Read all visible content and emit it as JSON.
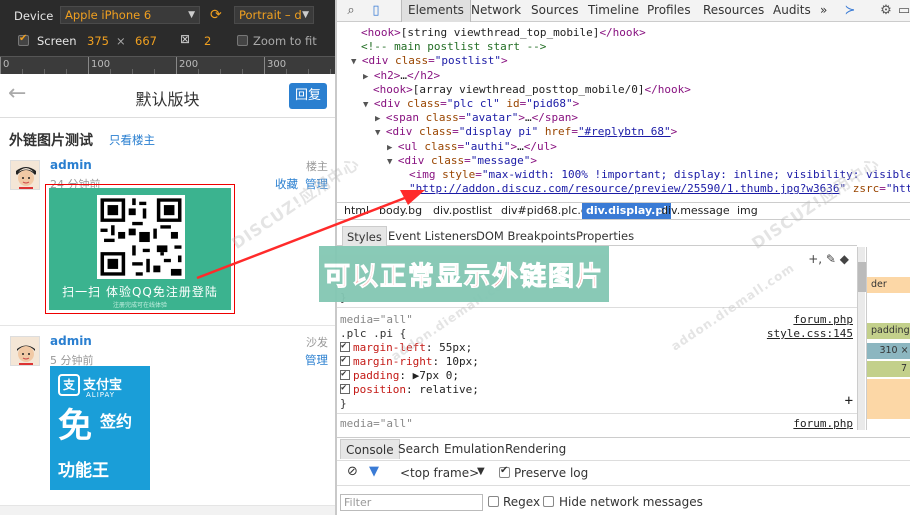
{
  "emulation": {
    "device_label": "Device",
    "device_value": "Apple iPhone 6",
    "orientation_value": "Portrait – d",
    "screen_label": "Screen",
    "screen_width": "375",
    "screen_times": "×",
    "screen_height": "667",
    "dpr_value": "2",
    "zoom_label": "Zoom to fit",
    "ruler_labels": [
      "0",
      "100",
      "200",
      "300"
    ]
  },
  "mobile": {
    "back_icon": "arrow-left-icon",
    "title": "默认版块",
    "reply_button": "回复",
    "thread_title": "外链图片测试",
    "only_author_link": "只看楼主",
    "posts": [
      {
        "author": "admin",
        "time": "24 分钟前",
        "floor": "楼主",
        "actions": [
          "收藏",
          "管理"
        ]
      },
      {
        "author": "admin",
        "time": "5 分钟前",
        "floor": "沙发",
        "actions": [
          "管理"
        ]
      }
    ],
    "qr_caption": "扫一扫 体验QQ免注册登陆",
    "qr_subcaption": "注册完成可在线体验",
    "alipay": {
      "logo": "支",
      "name": "支付宝",
      "en": "ALIPAY",
      "big": "免",
      "small": "签约",
      "bottom": "功能王"
    }
  },
  "devtools": {
    "tabs": [
      "Elements",
      "Network",
      "Sources",
      "Timeline",
      "Profiles",
      "Resources",
      "Audits"
    ],
    "more": "»",
    "dom_lines": [
      {
        "indent": 0,
        "tri": "",
        "parts": [
          [
            "tag",
            "<hook>"
          ],
          [
            "txt",
            "[string viewthread_top_mobile]"
          ],
          [
            "tag",
            "</hook>"
          ]
        ]
      },
      {
        "indent": 0,
        "tri": "",
        "parts": [
          [
            "com",
            "<!-- main postlist start -->"
          ]
        ]
      },
      {
        "indent": 0,
        "tri": "▼",
        "parts": [
          [
            "tag",
            "<div "
          ],
          [
            "attr",
            "class"
          ],
          [
            "tag",
            "="
          ],
          [
            "val",
            "\"postlist\""
          ],
          [
            "tag",
            ">"
          ]
        ]
      },
      {
        "indent": 1,
        "tri": "▶",
        "parts": [
          [
            "tag",
            "<h2>"
          ],
          [
            "txt",
            "…"
          ],
          [
            "tag",
            "</h2>"
          ]
        ]
      },
      {
        "indent": 1,
        "tri": "",
        "parts": [
          [
            "tag",
            "<hook>"
          ],
          [
            "txt",
            "[array viewthread_posttop_mobile/0]"
          ],
          [
            "tag",
            "</hook>"
          ]
        ]
      },
      {
        "indent": 1,
        "tri": "▼",
        "parts": [
          [
            "tag",
            "<div "
          ],
          [
            "attr",
            "class"
          ],
          [
            "tag",
            "="
          ],
          [
            "val",
            "\"plc cl\" "
          ],
          [
            "attr",
            "id"
          ],
          [
            "tag",
            "="
          ],
          [
            "val",
            "\"pid68\""
          ],
          [
            "tag",
            ">"
          ]
        ]
      },
      {
        "indent": 2,
        "tri": "▶",
        "parts": [
          [
            "tag",
            "<span "
          ],
          [
            "attr",
            "class"
          ],
          [
            "tag",
            "="
          ],
          [
            "val",
            "\"avatar\""
          ],
          [
            "tag",
            ">"
          ],
          [
            "txt",
            "…"
          ],
          [
            "tag",
            "</span>"
          ]
        ]
      },
      {
        "indent": 2,
        "tri": "▼",
        "parts": [
          [
            "tag",
            "<div "
          ],
          [
            "attr",
            "class"
          ],
          [
            "tag",
            "="
          ],
          [
            "val",
            "\"display pi\" "
          ],
          [
            "attr",
            "href"
          ],
          [
            "tag",
            "="
          ],
          [
            "lnk",
            "\"#replybtn 68\""
          ],
          [
            "tag",
            ">"
          ]
        ]
      },
      {
        "indent": 3,
        "tri": "▶",
        "parts": [
          [
            "tag",
            "<ul "
          ],
          [
            "attr",
            "class"
          ],
          [
            "tag",
            "="
          ],
          [
            "val",
            "\"authi\""
          ],
          [
            "tag",
            ">"
          ],
          [
            "txt",
            "…"
          ],
          [
            "tag",
            "</ul>"
          ]
        ]
      },
      {
        "indent": 3,
        "tri": "▼",
        "parts": [
          [
            "tag",
            "<div "
          ],
          [
            "attr",
            "class"
          ],
          [
            "tag",
            "="
          ],
          [
            "val",
            "\"message\""
          ],
          [
            "tag",
            ">"
          ]
        ]
      },
      {
        "indent": 4,
        "tri": "",
        "parts": [
          [
            "tag",
            "<img "
          ],
          [
            "attr",
            "style"
          ],
          [
            "tag",
            "="
          ],
          [
            "val",
            "\"max-width: 100% !important; display: inline; visibility: visible;\""
          ]
        ]
      },
      {
        "indent": 4,
        "tri": "",
        "parts": [
          [
            "val",
            "\""
          ],
          [
            "lnk",
            "http://addon.discuz.com/resource/preview/25590/1.thumb.jpg?w3636"
          ],
          [
            "val",
            "\" "
          ],
          [
            "attr",
            "zsrc"
          ],
          [
            "tag",
            "="
          ],
          [
            "val",
            "\"http:"
          ]
        ]
      }
    ],
    "breadcrumbs": [
      "html",
      "body.bg",
      "div.postlist",
      "div#pid68.plc.cl",
      "div.display.pi",
      "div.message",
      "img"
    ],
    "active_crumb": "div.display.pi",
    "sub_tabs": [
      "Styles",
      "Event Listeners",
      "DOM Breakpoints",
      "Properties"
    ],
    "styles": {
      "brace_close_1": "}",
      "media_1": "media=\"all\"",
      "source_1a": "forum.php",
      "selector": ".plc .pi {",
      "source_1b": "style.css:145",
      "props": [
        {
          "name": "margin-left",
          "value": "55px;"
        },
        {
          "name": "margin-right",
          "value": "10px;"
        },
        {
          "name": "padding",
          "value": "▶7px 0;"
        },
        {
          "name": "position",
          "value": "relative;"
        }
      ],
      "brace_close_2": "}",
      "media_2": "media=\"all\"",
      "source_2": "forum.php",
      "add_icon": "+"
    },
    "box_model": [
      "der",
      "padding7",
      "310 ×",
      "7"
    ],
    "console_tabs": [
      "Console",
      "Search",
      "Emulation",
      "Rendering"
    ],
    "frame_select": "<top frame>",
    "preserve_log": "Preserve log",
    "filter_placeholder": "Filter",
    "regex_label": "Regex",
    "hide_network": "Hide network messages"
  },
  "annotation": {
    "text": "可以正常显示外链图片",
    "color": "#ff2a2a"
  },
  "watermarks": [
    "DISCUZ!应用中心",
    "addon.diemall.com"
  ]
}
